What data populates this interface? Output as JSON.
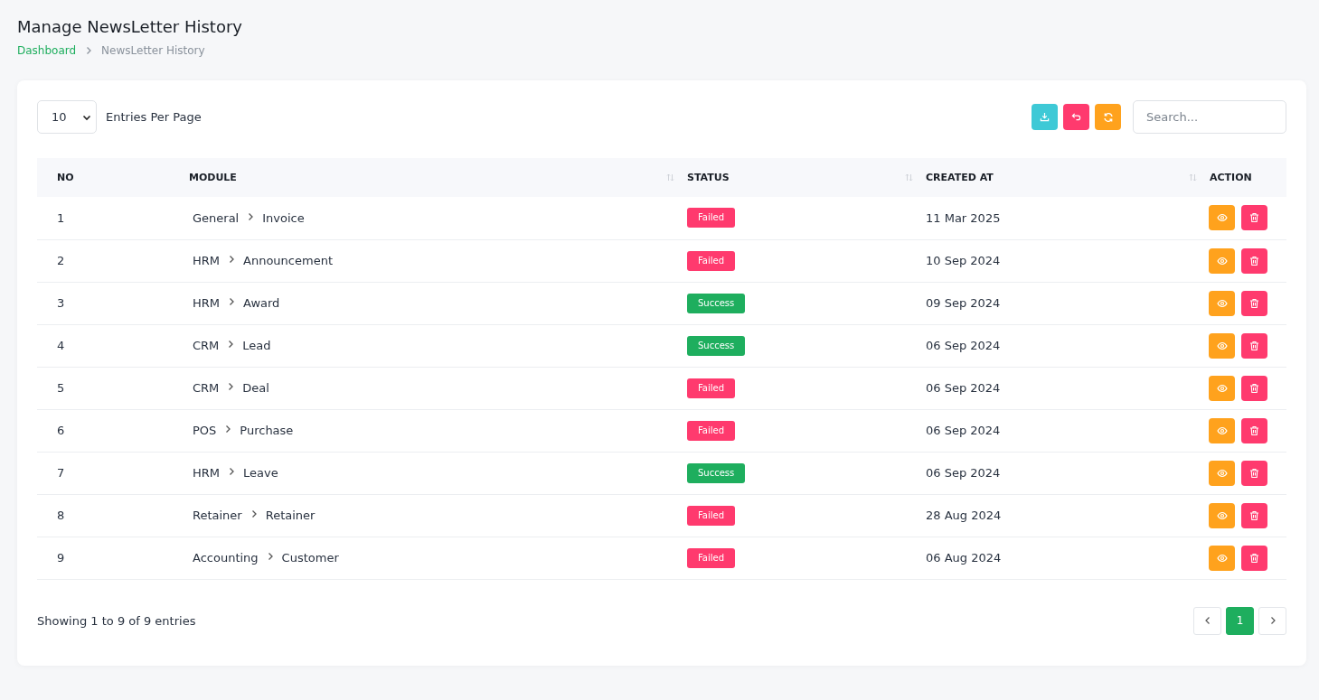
{
  "page_title": "Manage NewsLetter History",
  "breadcrumb": [
    {
      "label": "Dashboard",
      "selected": false
    },
    {
      "label": "NewsLetter History",
      "selected": true
    }
  ],
  "entries": {
    "value": "10",
    "label": "Entries Per Page"
  },
  "search": {
    "placeholder": "Search..."
  },
  "table": {
    "columns": [
      {
        "label": "NO",
        "sortable": false
      },
      {
        "label": "MODULE",
        "sortable": true
      },
      {
        "label": "STATUS",
        "sortable": true
      },
      {
        "label": "CREATED AT",
        "sortable": true
      },
      {
        "label": "ACTION",
        "sortable": false
      }
    ],
    "rows": [
      {
        "no": "1",
        "module": "General",
        "submodule": "Invoice",
        "status": {
          "label": "Failed",
          "kind": "failed"
        },
        "created_at": "11 Mar 2025"
      },
      {
        "no": "2",
        "module": "HRM",
        "submodule": "Announcement",
        "status": {
          "label": "Failed",
          "kind": "failed"
        },
        "created_at": "10 Sep 2024"
      },
      {
        "no": "3",
        "module": "HRM",
        "submodule": "Award",
        "status": {
          "label": "Success",
          "kind": "success"
        },
        "created_at": "09 Sep 2024"
      },
      {
        "no": "4",
        "module": "CRM",
        "submodule": "Lead",
        "status": {
          "label": "Success",
          "kind": "success"
        },
        "created_at": "06 Sep 2024"
      },
      {
        "no": "5",
        "module": "CRM",
        "submodule": "Deal",
        "status": {
          "label": "Failed",
          "kind": "failed"
        },
        "created_at": "06 Sep 2024"
      },
      {
        "no": "6",
        "module": "POS",
        "submodule": "Purchase",
        "status": {
          "label": "Failed",
          "kind": "failed"
        },
        "created_at": "06 Sep 2024"
      },
      {
        "no": "7",
        "module": "HRM",
        "submodule": "Leave",
        "status": {
          "label": "Success",
          "kind": "success"
        },
        "created_at": "06 Sep 2024"
      },
      {
        "no": "8",
        "module": "Retainer",
        "submodule": "Retainer",
        "status": {
          "label": "Failed",
          "kind": "failed"
        },
        "created_at": "28 Aug 2024"
      },
      {
        "no": "9",
        "module": "Accounting",
        "submodule": "Customer",
        "status": {
          "label": "Failed",
          "kind": "failed"
        },
        "created_at": "06 Aug 2024"
      }
    ]
  },
  "footer": {
    "summary": "Showing 1 to 9 of 9 entries",
    "pages": [
      {
        "label": "1",
        "selected": true
      }
    ]
  }
}
